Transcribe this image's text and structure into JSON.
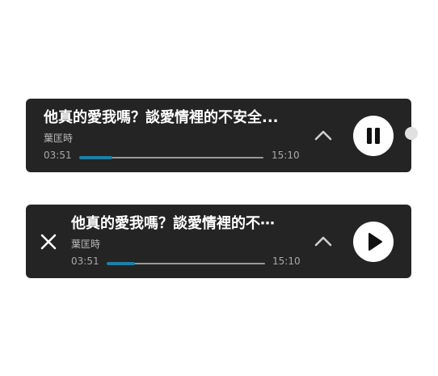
{
  "players": [
    {
      "title": "他真的愛我嗎？談愛情裡的不安全...",
      "artist": "葉匡時",
      "current_time": "03:51",
      "total_time": "15:10",
      "progress_fraction": 0.18,
      "state": "playing",
      "play_pause_icon": "pause-icon",
      "expand_icon": "chevron-up-icon"
    },
    {
      "title": "他真的愛我嗎？談愛情裡的不⋯",
      "artist": "葉匡時",
      "current_time": "03:51",
      "total_time": "15:10",
      "progress_fraction": 0.18,
      "state": "paused",
      "play_pause_icon": "play-icon",
      "expand_icon": "chevron-up-icon",
      "close_icon": "close-icon"
    }
  ],
  "colors": {
    "player_bg": "#242424",
    "progress_fill": "#1f7fa8",
    "progress_track": "#9a9a9a",
    "button_bg": "#ffffff"
  }
}
